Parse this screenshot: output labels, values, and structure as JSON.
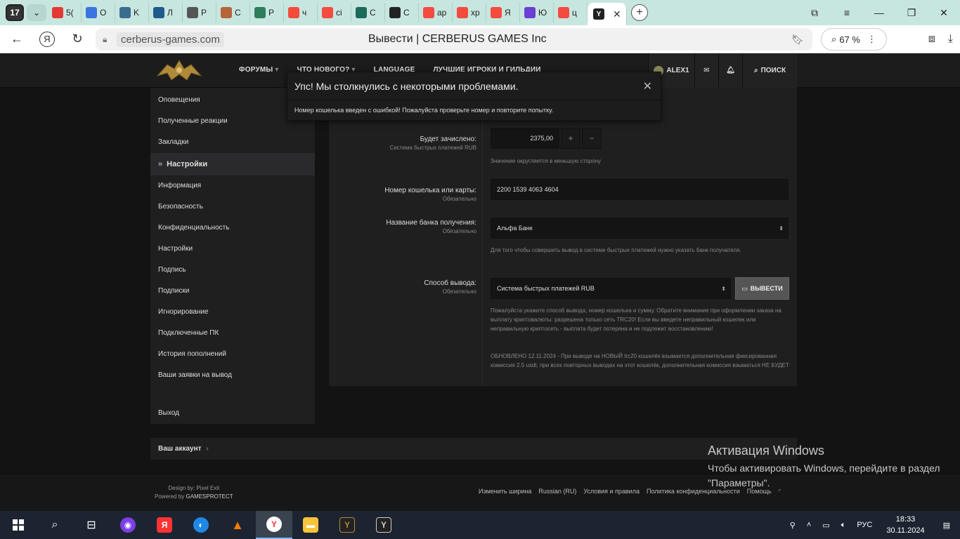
{
  "browser": {
    "tab_count": "17",
    "tabs": [
      {
        "label": "5(",
        "icon": "mail-icon",
        "color": "#e53935"
      },
      {
        "label": "O",
        "icon": "cube-icon",
        "color": "#3b73e0"
      },
      {
        "label": "K",
        "icon": "chart-icon",
        "color": "#3a6e8f"
      },
      {
        "label": "Л",
        "icon": "graph-icon",
        "color": "#1e5c8c"
      },
      {
        "label": "Р",
        "icon": "doc-icon",
        "color": "#555555"
      },
      {
        "label": "С",
        "icon": "picture-icon",
        "color": "#b4653a"
      },
      {
        "label": "Р",
        "icon": "globe-icon",
        "color": "#2e7d5b"
      },
      {
        "label": "ч",
        "icon": "yandex-icon",
        "color": "#f34b3e"
      },
      {
        "label": "сі",
        "icon": "yandex-icon",
        "color": "#f34b3e"
      },
      {
        "label": "С",
        "icon": "circle-icon",
        "color": "#1a6b5a"
      },
      {
        "label": "С",
        "icon": "site-icon",
        "color": "#222222"
      },
      {
        "label": "ар",
        "icon": "yandex-icon",
        "color": "#f34b3e"
      },
      {
        "label": "хр",
        "icon": "yandex-icon",
        "color": "#f34b3e"
      },
      {
        "label": "Я",
        "icon": "yandex-icon",
        "color": "#f34b3e"
      },
      {
        "label": "Ю",
        "icon": "purple-icon",
        "color": "#6b3fd4"
      },
      {
        "label": "ц",
        "icon": "yandex-icon",
        "color": "#f34b3e"
      }
    ],
    "url_domain": "cerberus-games.com",
    "page_title": "Вывести | CERBERUS GAMES Inc",
    "zoom": "67 %"
  },
  "site": {
    "topnav": [
      "ФОРУМЫ",
      "ЧТО НОВОГО?",
      "LANGUAGE",
      "ЛУЧШИЕ ИГРОКИ И ГИЛЬДИИ"
    ],
    "username": "ALEX1",
    "search_label": "ПОИСК",
    "sidebar": {
      "items": [
        "Оповещения",
        "Полученные реакции",
        "Закладки",
        "Настройки",
        "Информация",
        "Безопасность",
        "Конфиденциальность",
        "Настройки",
        "Подпись",
        "Подписки",
        "Игнорирование",
        "Подключенные ПК",
        "История пополнений",
        "Ваши заявки на вывод"
      ],
      "exit": "Выход",
      "account": "Ваш аккаунт"
    },
    "form": {
      "credit_label": "Будет зачислено:",
      "credit_sub": "Система быстрых платежей RUB",
      "credit_value": "2375,00",
      "credit_hint": "Значение округляется в меньшую сторону",
      "wallet_label": "Номер кошелька или карты:",
      "wallet_sub": "Обязательно",
      "wallet_value": "2200 1539 4063 4604",
      "bank_label": "Название банка получения:",
      "bank_sub": "Обязательно",
      "bank_value": "Альфа Банк",
      "bank_hint": "Для того чтобы совершить вывод в системе быстрых платежей нужно указать банк получателя.",
      "method_label": "Способ вывода:",
      "method_sub": "Обязательно",
      "method_value": "Система быстрых платежей RUB",
      "withdraw_button": "ВЫВЕСТИ",
      "note1": "Пожалуйста укажите способ вывода, номер кошелька и сумму. Обратите внимание при оформлении заказа на выплату криптовалюты: разрешена только сеть TRC20! Если вы введете неправильный кошелек или неправильную криптосеть - выплата будет потеряна и не подлежит восстановлению!",
      "note2": "ОБНОВЛЕНО 12.11.2024 - При выводе на НОВЫЙ trc20 кошелёк взымается дополнительная фиксированная комиссия 2.5 usdt, при всех повторных выводах на этот кошелёк, дополнительная комиссия взыматься НЕ БУДЕТ"
    },
    "error": {
      "title": "Упс! Мы столкнулись с некоторыми проблемами.",
      "message": "Номер кошелька введен с ошибкой! Пожалуйста проверьте номер и повторите попытку."
    },
    "footer": {
      "design": "Design by: Pixel Exit",
      "powered": "Powered by",
      "powered_name": "GAMESPROTECT",
      "links": [
        "Изменить ширина",
        "Russian (RU)",
        "Условия и правила",
        "Политика конфиденциальности",
        "Помощь"
      ]
    }
  },
  "windows": {
    "activate_title": "Активация Windows",
    "activate_text": "Чтобы активировать Windows, перейдите в раздел \"Параметры\".",
    "lang": "РУС",
    "time": "18:33",
    "date": "30.11.2024"
  }
}
